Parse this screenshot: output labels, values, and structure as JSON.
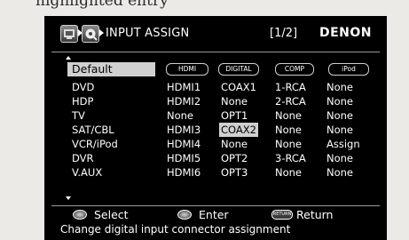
{
  "header": {
    "title": "INPUT ASSIGN",
    "page": "[1/2]",
    "brand": "DENON"
  },
  "table": {
    "default_label": "Default",
    "columns": [
      "HDMI",
      "DIGITAL",
      "COMP",
      "iPod"
    ],
    "rows": [
      {
        "source": "DVD",
        "hdmi": "HDMI1",
        "digital": "COAX1",
        "comp": "1-RCA",
        "ipod": "None"
      },
      {
        "source": "HDP",
        "hdmi": "HDMI2",
        "digital": "None",
        "comp": "2-RCA",
        "ipod": "None"
      },
      {
        "source": "TV",
        "hdmi": "None",
        "digital": "OPT1",
        "comp": "None",
        "ipod": "None"
      },
      {
        "source": "SAT/CBL",
        "hdmi": "HDMI3",
        "digital": "COAX2",
        "comp": "None",
        "ipod": "None"
      },
      {
        "source": "VCR/iPod",
        "hdmi": "HDMI4",
        "digital": "None",
        "comp": "None",
        "ipod": "Assign"
      },
      {
        "source": "DVR",
        "hdmi": "HDMI5",
        "digital": "OPT2",
        "comp": "3-RCA",
        "ipod": "None"
      },
      {
        "source": "V.AUX",
        "hdmi": "HDMI6",
        "digital": "OPT3",
        "comp": "None",
        "ipod": "None"
      }
    ]
  },
  "footer": {
    "select_label": "Select",
    "enter_label": "Enter",
    "return_button": "RETURN",
    "return_label": "Return",
    "help_text": "Change digital input connector assignment"
  },
  "icons": [
    "setup-menu-icon",
    "source-icon",
    "enter-dial-icon",
    "return-button-icon"
  ],
  "colors": {
    "screen_bg": "#000000",
    "text": "#ffffff",
    "highlight": "#d0d0d0"
  }
}
